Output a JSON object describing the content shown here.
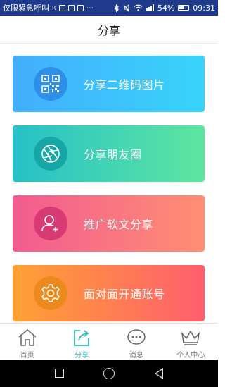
{
  "status_bar": {
    "carrier": "仅限紧急呼叫",
    "r_indicator": "R",
    "dots": "···",
    "battery_percent": "54%",
    "time": "09:31"
  },
  "header": {
    "title": "分享"
  },
  "cards": [
    {
      "label": "分享二维码图片",
      "icon": "qr-code-icon"
    },
    {
      "label": "分享朋友圈",
      "icon": "camera-aperture-icon"
    },
    {
      "label": "推广软文分享",
      "icon": "add-user-icon"
    },
    {
      "label": "面对面开通账号",
      "icon": "gear-icon"
    }
  ],
  "tabs": [
    {
      "label": "首页",
      "icon": "home-icon",
      "active": false
    },
    {
      "label": "分享",
      "icon": "share-icon",
      "active": true
    },
    {
      "label": "消息",
      "icon": "message-icon",
      "active": false
    },
    {
      "label": "个人中心",
      "icon": "crown-icon",
      "active": false
    }
  ],
  "colors": {
    "status_bar": "#1f3a8a",
    "active_tab": "#2bbcb7",
    "card_blue": "#43aefc",
    "card_green": "#26c0c8",
    "card_pink": "#f25b91",
    "card_orange": "#ffa233"
  }
}
